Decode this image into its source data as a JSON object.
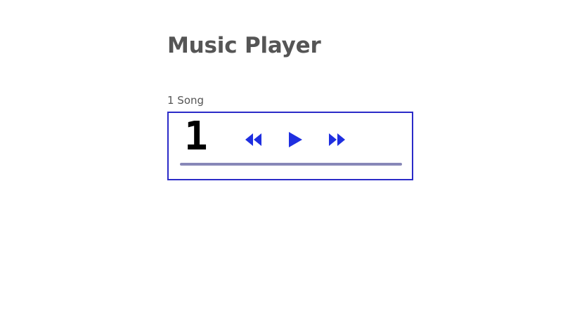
{
  "page": {
    "title": "Music Player",
    "song_count_label": "1 Song"
  },
  "player": {
    "track_number": "1",
    "controls": [
      {
        "name": "rewind",
        "icon": "rewind-icon"
      },
      {
        "name": "play",
        "icon": "play-icon"
      },
      {
        "name": "fast-forward",
        "icon": "fast-forward-icon"
      }
    ],
    "progress": 0
  },
  "colors": {
    "accent": "#2b2bc8",
    "control_icon": "#1f2fe0",
    "progress_track": "#8888b8",
    "text": "#555555",
    "track_number": "#000000"
  }
}
